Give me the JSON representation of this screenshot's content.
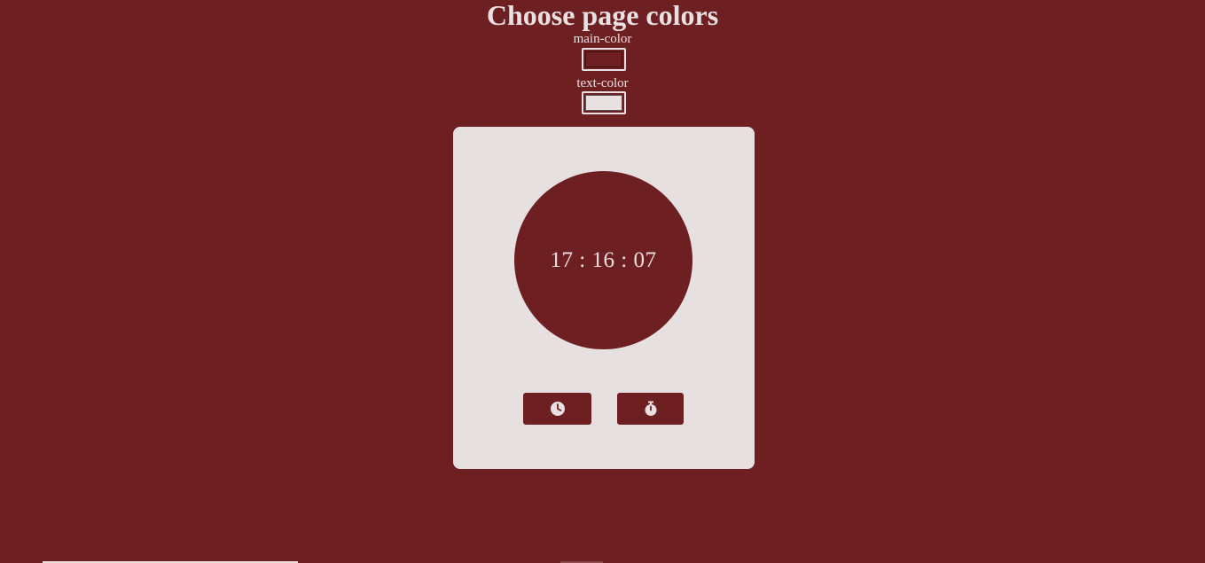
{
  "header": {
    "title": "Choose page colors"
  },
  "color_pickers": {
    "main_color": {
      "label": "main-color",
      "value": "#6e1f21"
    },
    "text_color": {
      "label": "text-color",
      "value": "#e8e0e1"
    }
  },
  "clock": {
    "time": "17 : 16 : 07"
  },
  "buttons": {
    "clock_icon": "clock-icon",
    "timer_icon": "stopwatch-icon"
  },
  "colors": {
    "background": "#6e1f21",
    "card": "#e7e0e1",
    "text": "#e8e0e1"
  }
}
